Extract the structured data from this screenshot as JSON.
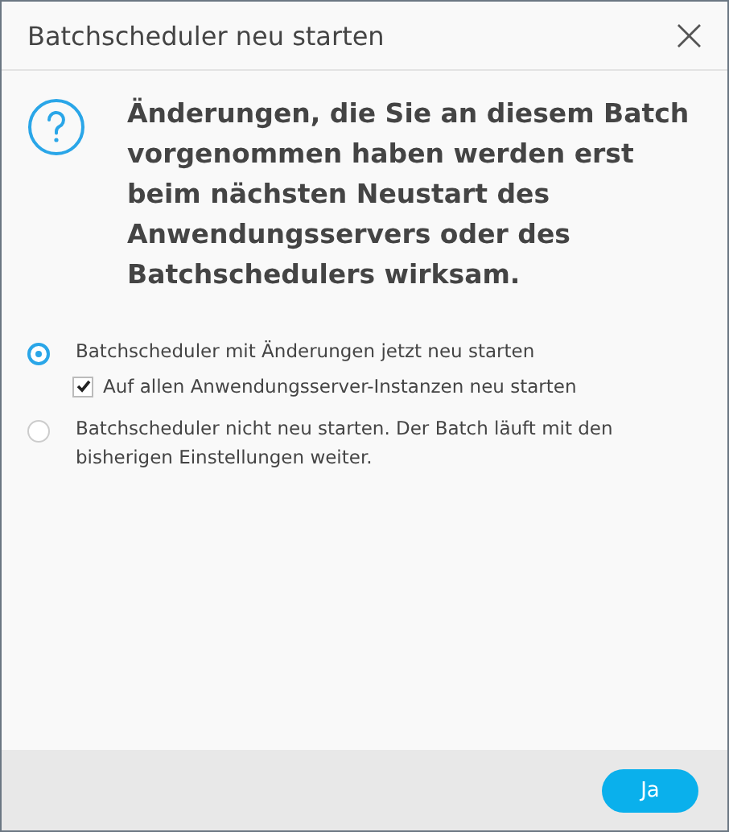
{
  "window": {
    "title": "Batchscheduler neu starten",
    "close": "×"
  },
  "message": "Änderungen, die Sie an diesem Batch vorgenommen haben werden erst beim nächsten Neustart des Anwendungsservers oder des Batchschedulers wirksam.",
  "options": [
    {
      "label": "Batchscheduler mit Änderungen jetzt neu starten",
      "selected": true,
      "checkbox": {
        "label": "Auf allen Anwendungsserver-Instanzen neu starten",
        "checked": true
      }
    },
    {
      "label": "Batchscheduler nicht neu starten. Der Batch läuft mit den bisherigen Einstellungen weiter.",
      "selected": false
    }
  ],
  "buttons": [
    "Ja"
  ]
}
